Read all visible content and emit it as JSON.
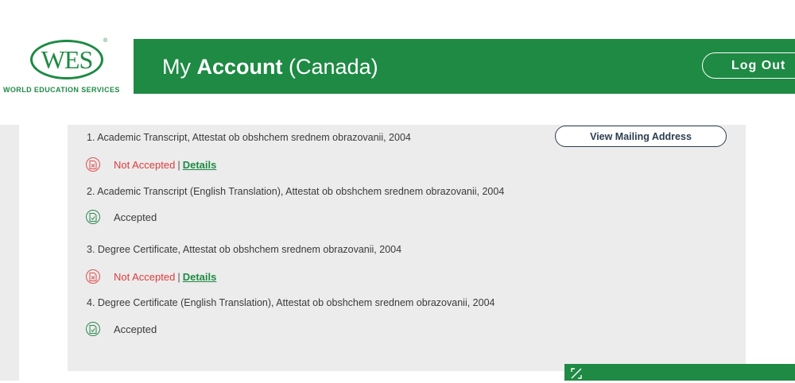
{
  "logo": {
    "mark": "WES",
    "reg": "®",
    "subtitle": "WORLD EDUCATION SERVICES"
  },
  "header": {
    "title_prefix": "My",
    "title_bold": "Account",
    "title_suffix": "(Canada)",
    "logout_label": "Log Out"
  },
  "panel": {
    "mailing_button_label": "View Mailing Address",
    "documents": [
      {
        "title": "1. Academic Transcript, Attestat ob obshchem srednem obrazovanii, 2004",
        "status": "Not Accepted",
        "separator": "|",
        "details_label": "Details"
      },
      {
        "title": "2. Academic Transcript (English Translation), Attestat ob obshchem srednem obrazovanii, 2004",
        "status": "Accepted"
      },
      {
        "title": "3. Degree Certificate, Attestat ob obshchem srednem obrazovanii, 2004",
        "status": "Not Accepted",
        "separator": "|",
        "details_label": "Details"
      },
      {
        "title": "4. Degree Certificate (English Translation), Attestat ob obshchem srednem obrazovanii, 2004",
        "status": "Accepted"
      }
    ]
  },
  "icons": {
    "not_accepted": "document-rejected-icon",
    "accepted": "document-accepted-icon",
    "expand": "expand-icon"
  },
  "colors": {
    "brand_green": "#1e8a44",
    "rejected_red": "#e03a3a",
    "panel_gray": "#ececec"
  }
}
